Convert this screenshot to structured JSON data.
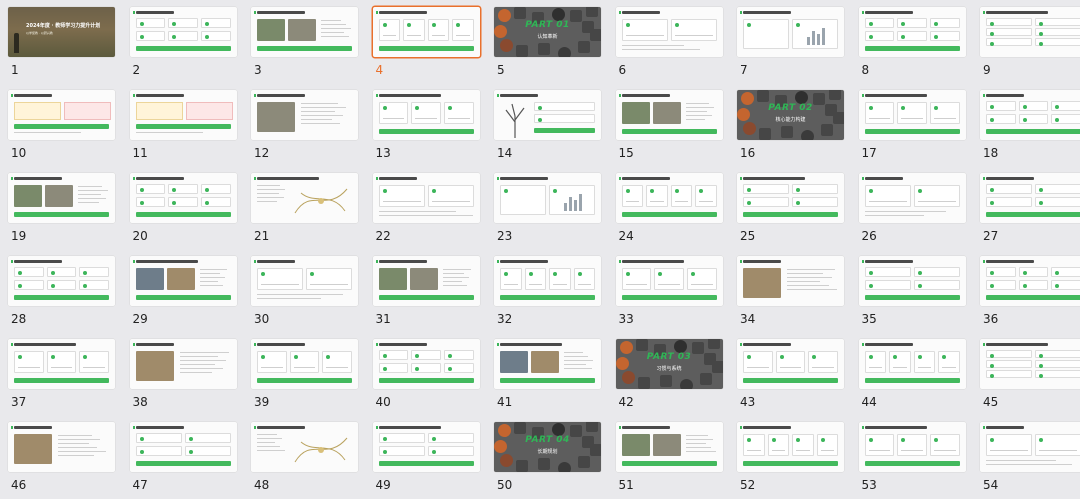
{
  "selected_slide": 4,
  "cover": {
    "title": "2024年度 · 教师学习力提升计划",
    "subtitle": "以学促教 · 以研兴教"
  },
  "parts": [
    {
      "slide": 5,
      "label": "PART 01",
      "title": "认知革新"
    },
    {
      "slide": 16,
      "label": "PART 02",
      "title": "核心能力构建"
    },
    {
      "slide": 42,
      "label": "PART 03",
      "title": "习惯与系统"
    },
    {
      "slide": 50,
      "label": "PART 04",
      "title": "长期规划"
    }
  ],
  "slides": [
    {
      "number": "1",
      "kind": "cover"
    },
    {
      "number": "2",
      "kind": "list"
    },
    {
      "number": "3",
      "kind": "photo-text"
    },
    {
      "number": "4",
      "kind": "cards"
    },
    {
      "number": "5",
      "kind": "part"
    },
    {
      "number": "6",
      "kind": "cards"
    },
    {
      "number": "7",
      "kind": "chart"
    },
    {
      "number": "8",
      "kind": "list"
    },
    {
      "number": "9",
      "kind": "grid"
    },
    {
      "number": "10",
      "kind": "notes"
    },
    {
      "number": "11",
      "kind": "notes"
    },
    {
      "number": "12",
      "kind": "photo-text"
    },
    {
      "number": "13",
      "kind": "cards"
    },
    {
      "number": "14",
      "kind": "tree"
    },
    {
      "number": "15",
      "kind": "photo-text"
    },
    {
      "number": "16",
      "kind": "part"
    },
    {
      "number": "17",
      "kind": "cards"
    },
    {
      "number": "18",
      "kind": "list"
    },
    {
      "number": "19",
      "kind": "photo-text"
    },
    {
      "number": "20",
      "kind": "list"
    },
    {
      "number": "21",
      "kind": "map"
    },
    {
      "number": "22",
      "kind": "cards"
    },
    {
      "number": "23",
      "kind": "chart"
    },
    {
      "number": "24",
      "kind": "cards"
    },
    {
      "number": "25",
      "kind": "list"
    },
    {
      "number": "26",
      "kind": "cards"
    },
    {
      "number": "27",
      "kind": "list"
    },
    {
      "number": "28",
      "kind": "list"
    },
    {
      "number": "29",
      "kind": "photo-text"
    },
    {
      "number": "30",
      "kind": "cards"
    },
    {
      "number": "31",
      "kind": "photo-text"
    },
    {
      "number": "32",
      "kind": "cards"
    },
    {
      "number": "33",
      "kind": "cards"
    },
    {
      "number": "34",
      "kind": "photo-text"
    },
    {
      "number": "35",
      "kind": "list"
    },
    {
      "number": "36",
      "kind": "list"
    },
    {
      "number": "37",
      "kind": "cards"
    },
    {
      "number": "38",
      "kind": "photo-text"
    },
    {
      "number": "39",
      "kind": "cards"
    },
    {
      "number": "40",
      "kind": "list"
    },
    {
      "number": "41",
      "kind": "photo-text"
    },
    {
      "number": "42",
      "kind": "part"
    },
    {
      "number": "43",
      "kind": "cards"
    },
    {
      "number": "44",
      "kind": "cards"
    },
    {
      "number": "45",
      "kind": "grid"
    },
    {
      "number": "46",
      "kind": "photo-text"
    },
    {
      "number": "47",
      "kind": "list"
    },
    {
      "number": "48",
      "kind": "map"
    },
    {
      "number": "49",
      "kind": "list"
    },
    {
      "number": "50",
      "kind": "part"
    },
    {
      "number": "51",
      "kind": "photo-text"
    },
    {
      "number": "52",
      "kind": "cards"
    },
    {
      "number": "53",
      "kind": "cards"
    },
    {
      "number": "54",
      "kind": "cards"
    }
  ],
  "colors": {
    "accent": "#3cb55a",
    "selection": "#e9702c",
    "part_background": "#5d5d5d",
    "background": "#e9e9ec"
  }
}
